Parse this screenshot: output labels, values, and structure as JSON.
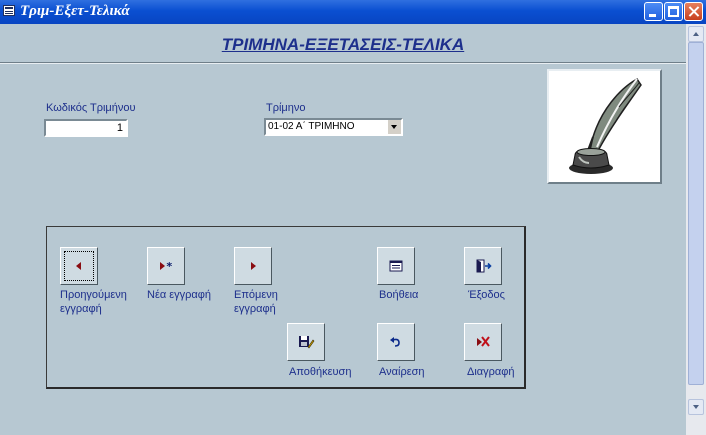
{
  "window": {
    "title": "Τριμ-Εξετ-Τελικά"
  },
  "header": {
    "title": "ΤΡΙΜΗΝΑ-ΕΞΕΤΑΣΕΙΣ-ΤΕΛΙΚΑ"
  },
  "fields": {
    "code": {
      "label": "Κωδικός Τριμήνου",
      "value": "1"
    },
    "trimester": {
      "label": "Τρίμηνο",
      "value": "01-02 Α΄ ΤΡΙΜΗΝΟ"
    }
  },
  "buttons": {
    "previous": {
      "line1": "Προηγούμενη",
      "line2": "εγγραφή",
      "icon": "prev-record-icon"
    },
    "new": {
      "line1": "Νέα εγγραφή",
      "icon": "new-record-icon"
    },
    "next": {
      "line1": "Επόμενη",
      "line2": "εγγραφή",
      "icon": "next-record-icon"
    },
    "help": {
      "line1": "Βοήθεια",
      "icon": "help-icon"
    },
    "exit": {
      "line1": "Έξοδος",
      "icon": "exit-door-icon"
    },
    "save": {
      "line1": "Αποθήκευση",
      "icon": "save-record-icon"
    },
    "undo": {
      "line1": "Αναίρεση",
      "icon": "undo-icon"
    },
    "delete": {
      "line1": "Διαγραφή",
      "icon": "delete-record-icon"
    }
  },
  "colors": {
    "background": "#b7c8d2",
    "title_text": "#1d2f8c",
    "titlebar": "#0a4fd1"
  }
}
